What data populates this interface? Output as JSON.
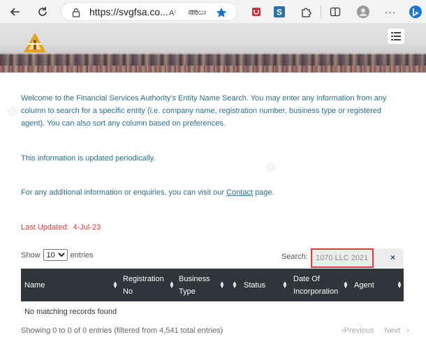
{
  "browser": {
    "url": "https://svgfsa.co...",
    "read_aloud": "A⁾",
    "translate": "അඍ",
    "extensions": [
      "shield-extension",
      "s-extension"
    ]
  },
  "header": {
    "menu_icon": "hamburger-menu-icon"
  },
  "intro": {
    "welcome": "Welcome to the Financial Services Authority's Entity Name Search. You may enter any information from any column to search for a specific entity (i.e. company name, registration number, business type or registered agent). You can also sort any column based on preferences.",
    "updated": "This information is updated periodically.",
    "contact_prefix": "For any additional information or enquiries, you can visit our ",
    "contact_link": "Contact",
    "contact_suffix": " page.",
    "last_updated_label": "Last Updated:",
    "last_updated_date": "4-Jul-23"
  },
  "controls": {
    "show_label": "Show",
    "show_value": "10",
    "entries_label": "entries",
    "search_label": "Search:",
    "search_value": "1070 LLC 2021",
    "clear": "×"
  },
  "table": {
    "columns": [
      "Name",
      "Registration No",
      "Business Type",
      "Status",
      "Date Of Incorporation",
      "Agent"
    ],
    "col1_l1": "Registration",
    "col1_l2": "No",
    "col2_l1": "Business",
    "col2_l2": "Type",
    "col4_l1": "Date Of",
    "col4_l2": "Incorporation",
    "empty_message": "No matching records found"
  },
  "footer": {
    "info": "Showing 0 to 0 of 0 entries (filtered from 4,541 total entries)",
    "previous": "Previous",
    "next": "Next"
  },
  "colors": {
    "text": "#2a6f8c",
    "accent_red": "#d0413c",
    "table_header": "#2f353a"
  }
}
